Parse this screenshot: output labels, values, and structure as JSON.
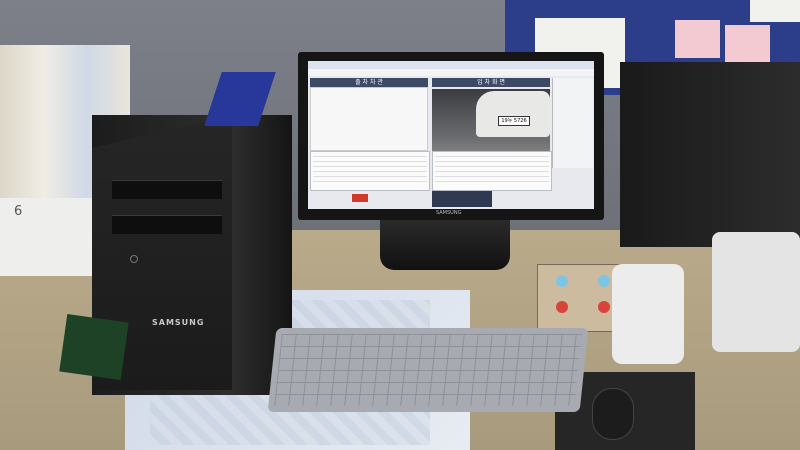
{
  "scene": {
    "description_tags": [
      "office-desk",
      "monitor",
      "pc-tower",
      "keyboard",
      "mouse",
      "phone",
      "control-box"
    ]
  },
  "monitor_screen": {
    "left_panel_title": "출 차 차 관",
    "right_panel_title": "입 차 화 면",
    "plate_text": "19누 5726",
    "monitor_brand": "SAMSUNG"
  },
  "pc_tower": {
    "brand": "SAMSUNG"
  },
  "calendar": {
    "month": "6"
  },
  "colors": {
    "screen_bg": "#e7e9ee",
    "panel_header": "#3d4a66",
    "alert_red": "#d03a2d",
    "pinboard_blue": "#2c3e8a"
  }
}
